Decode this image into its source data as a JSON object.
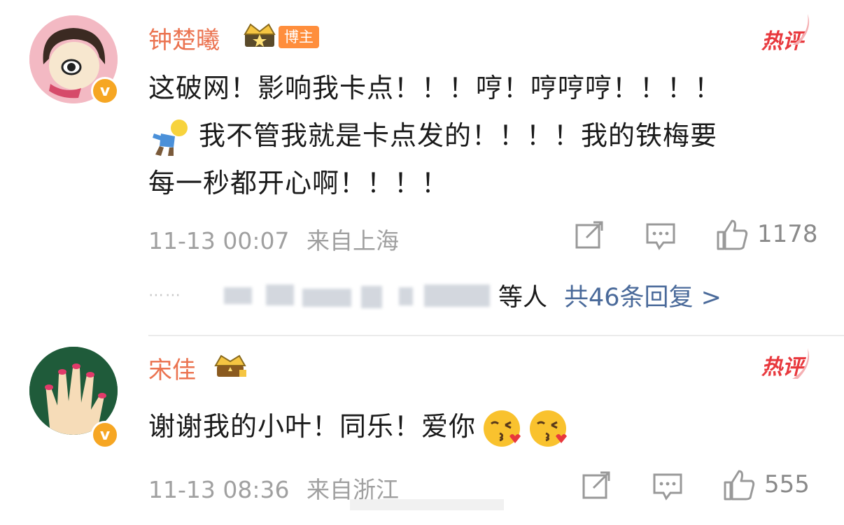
{
  "comments": [
    {
      "author": "钟楚曦",
      "blogger_tag": "博主",
      "hot_label": "热评",
      "text_lines": [
        "这破网！影响我卡点！！！哼！哼哼哼！！！！",
        "我不管我就是卡点发的！！！！我的铁梅要",
        "每一秒都开心啊！！！！"
      ],
      "inline_icon": "person-emoji",
      "timestamp": "11-13 00:07",
      "location": "来自上海",
      "likes": "1178",
      "reply_suffix": "等人",
      "reply_link": "共46条回复 >"
    },
    {
      "author": "宋佳",
      "hot_label": "热评",
      "text": "谢谢我的小叶！同乐！爱你",
      "inline_icons": [
        "kiss-emoji",
        "kiss-emoji"
      ],
      "timestamp": "11-13 08:36",
      "location": "来自浙江",
      "likes": "555"
    }
  ],
  "colors": {
    "accent_name": "#eb7350",
    "hot": "#e8383d",
    "link": "#4a6a9a",
    "meta": "#a0a0a0"
  }
}
